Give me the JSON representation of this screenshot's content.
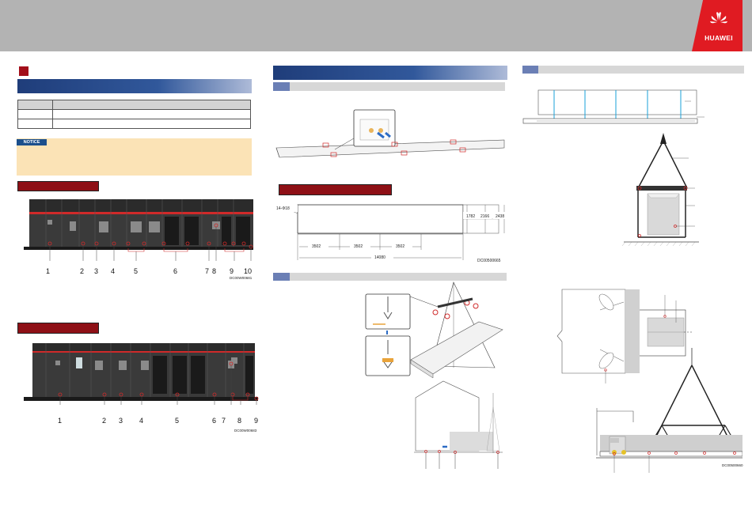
{
  "brand": {
    "name": "HUAWEI",
    "accent": "#e01b22",
    "blue": "#1f3d7a",
    "dark_red": "#8e1016"
  },
  "left": {
    "notice_label": "NOTICE",
    "figure1": {
      "callouts": [
        "1",
        "2",
        "3",
        "4",
        "5",
        "6",
        "7",
        "8",
        "9",
        "10"
      ],
      "code": "DC00W00681"
    },
    "figure2": {
      "callouts": [
        "1",
        "2",
        "3",
        "4",
        "5",
        "6",
        "7",
        "8",
        "9"
      ],
      "code": "DC00W00683"
    }
  },
  "middle": {
    "drawing": {
      "holes": "14-Φ18",
      "heights": [
        "1782",
        "2166",
        "2438"
      ],
      "spans": [
        "3502",
        "3502",
        "3502"
      ],
      "total": "14080",
      "code": "DC00500665"
    }
  },
  "right": {
    "code": "DC00500660"
  }
}
